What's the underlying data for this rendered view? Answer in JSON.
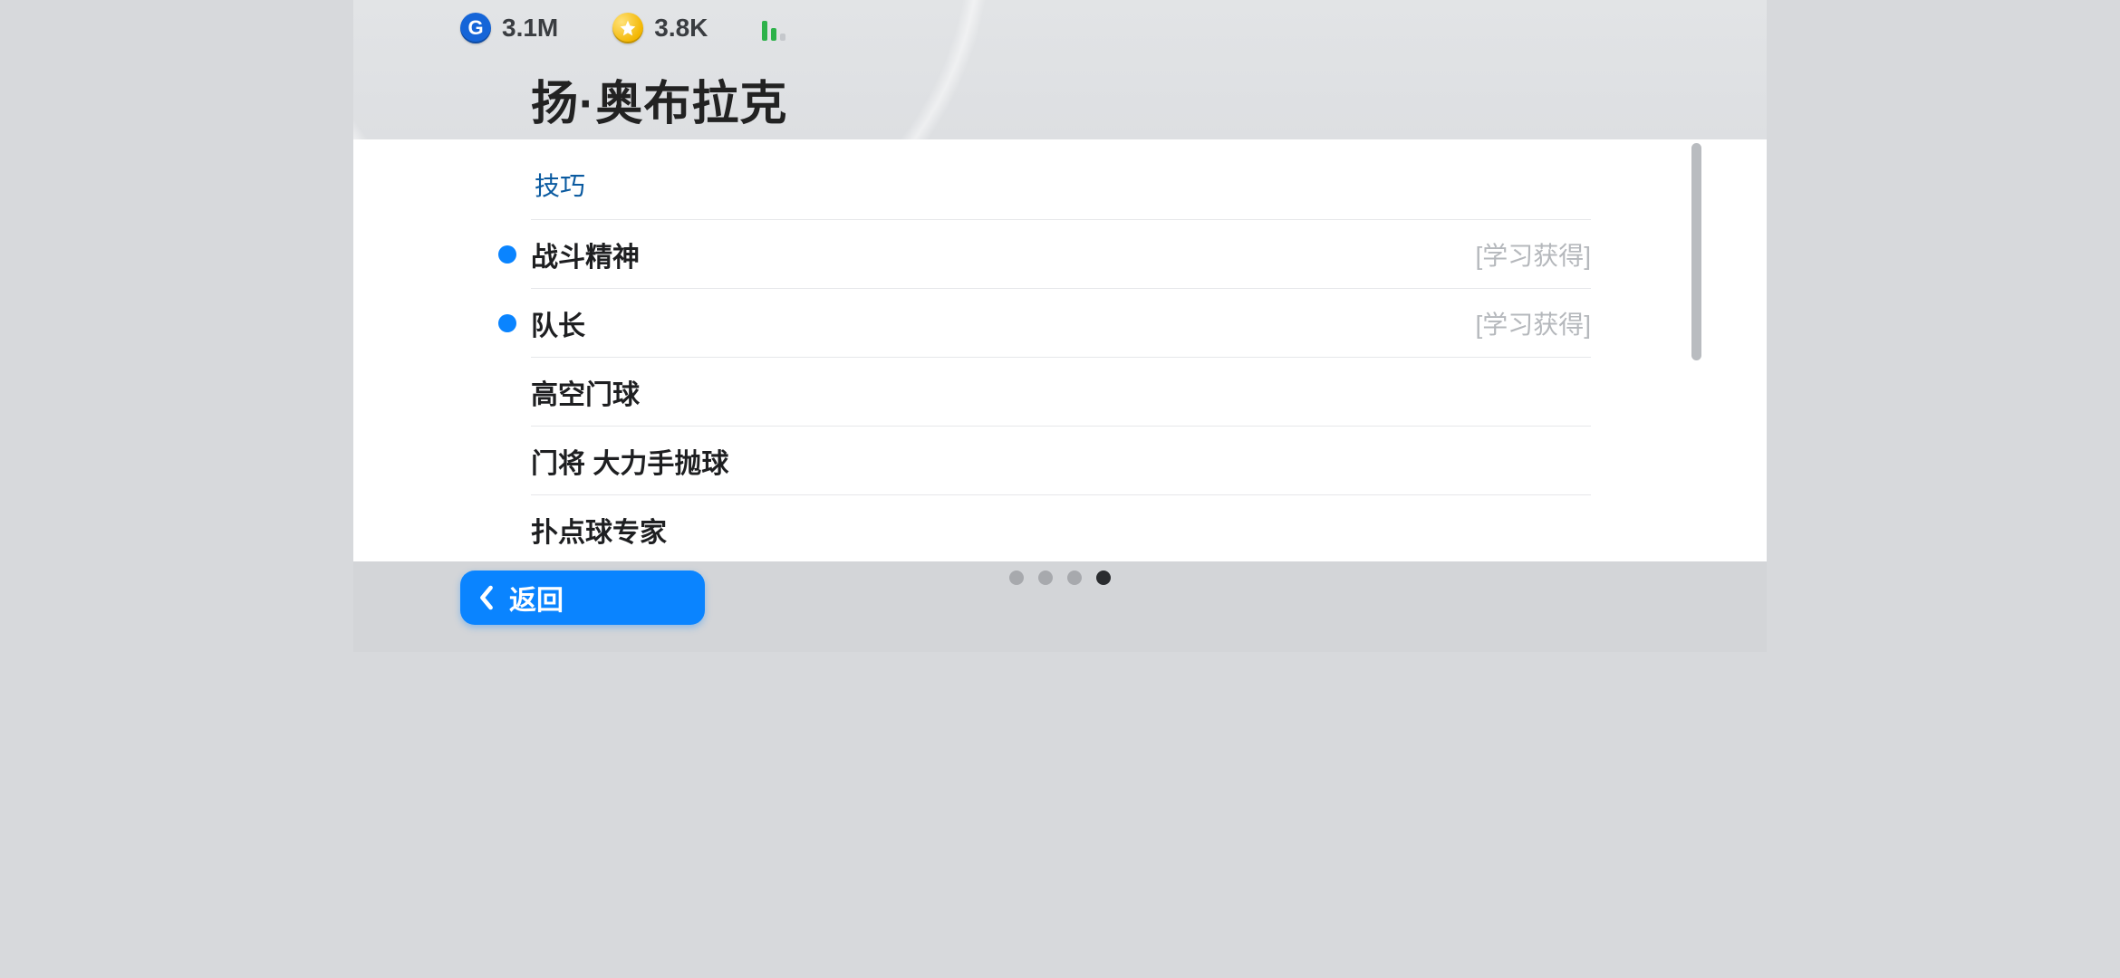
{
  "header": {
    "coins_label": "3.1M",
    "stars_label": "3.8K",
    "player_name": "扬·奥布拉克"
  },
  "skills": {
    "section_title": "技巧",
    "learned_tag": "[学习获得]",
    "items": [
      {
        "name": "战斗精神",
        "learned": true
      },
      {
        "name": "队长",
        "learned": true
      },
      {
        "name": "高空门球",
        "learned": false
      },
      {
        "name": "门将 大力手抛球",
        "learned": false
      },
      {
        "name": "扑点球专家",
        "learned": false
      }
    ]
  },
  "footer": {
    "back_label": "返回",
    "page_count": 4,
    "active_page": 4
  }
}
